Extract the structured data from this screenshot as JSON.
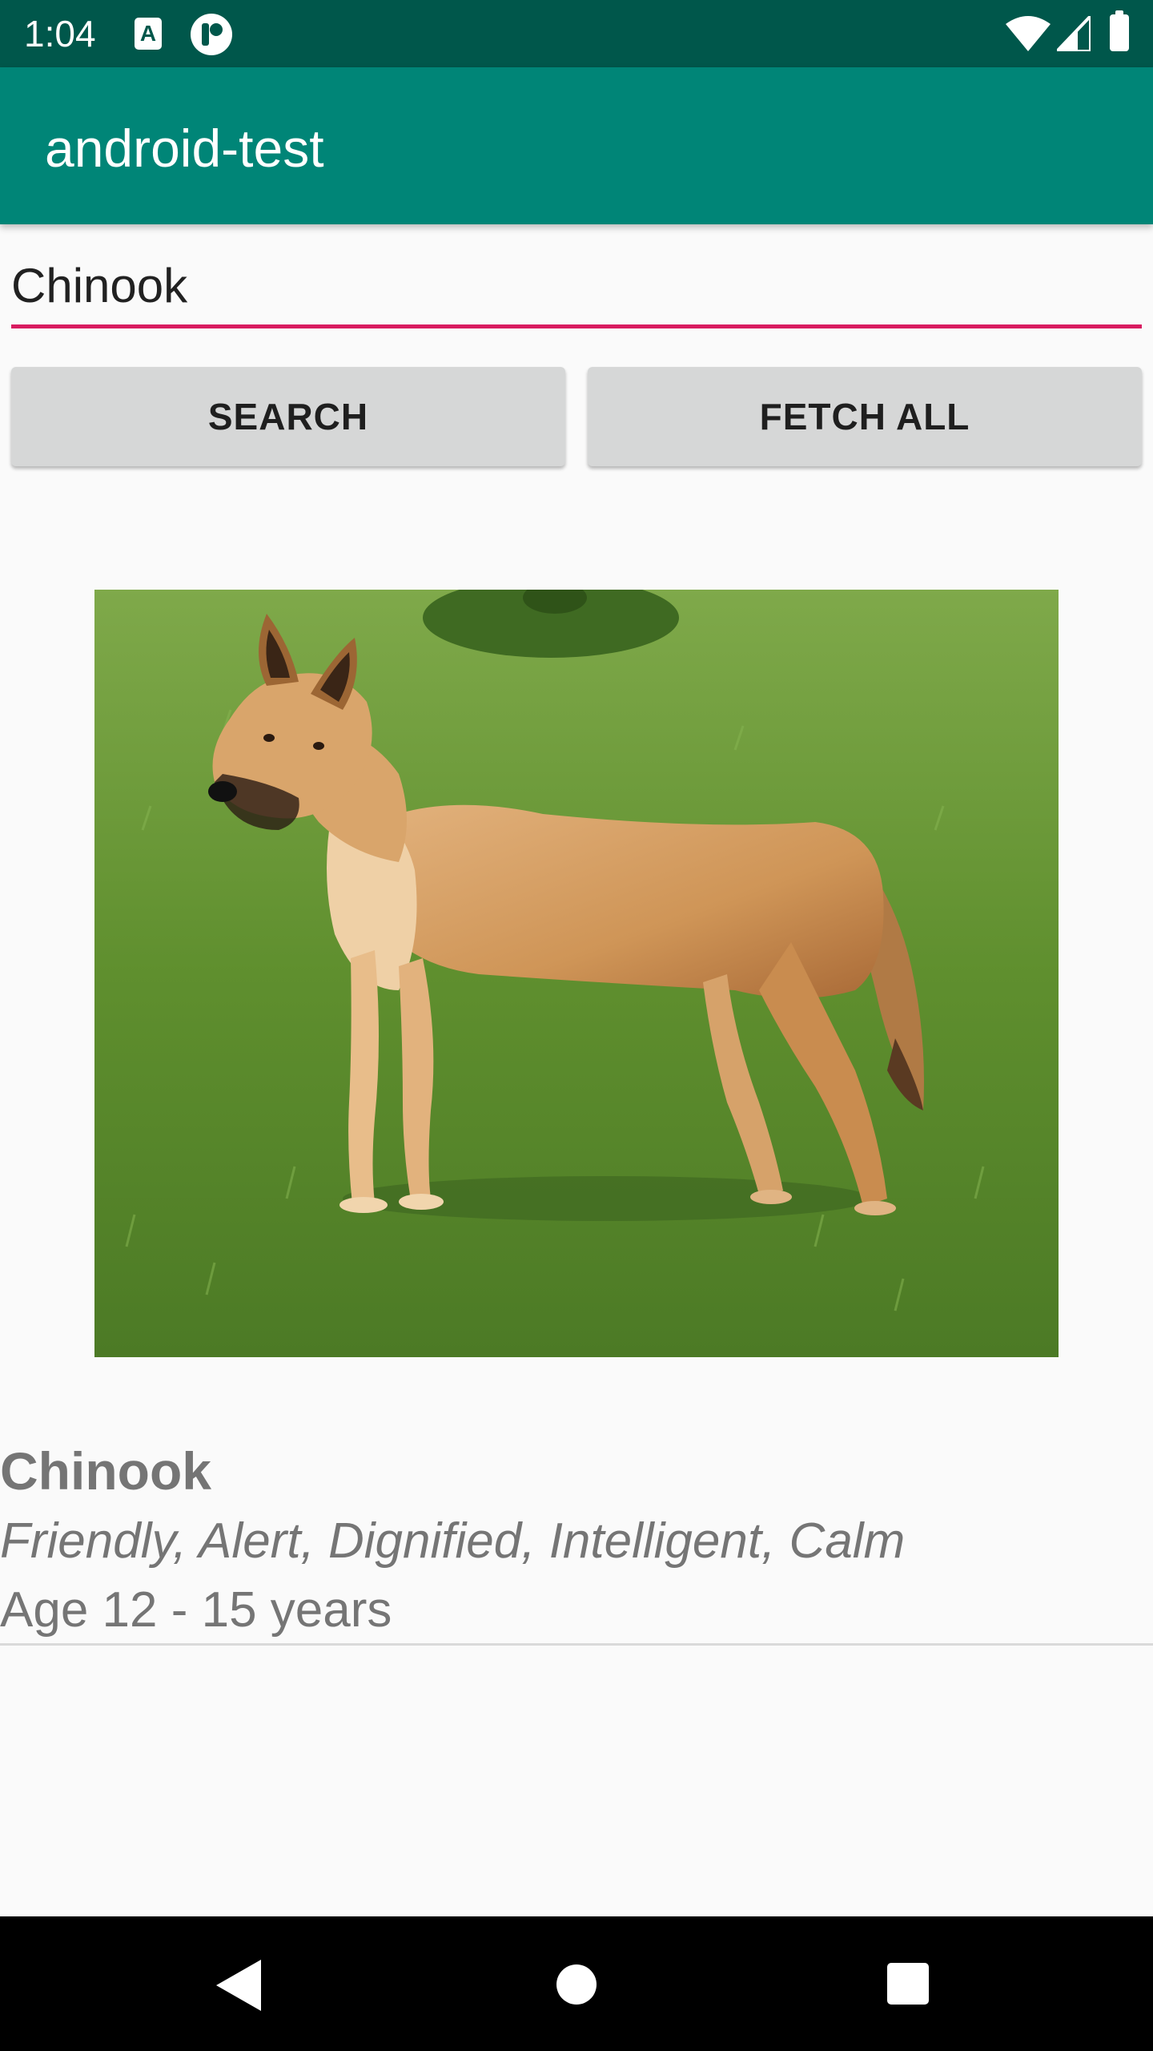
{
  "status_bar": {
    "time": "1:04",
    "icons": [
      "text-a-icon",
      "pocket-p-icon",
      "wifi-icon",
      "signal-icon",
      "battery-icon"
    ],
    "background": "#00574b"
  },
  "app_bar": {
    "title": "android-test",
    "background": "#008577"
  },
  "search": {
    "value": "Chinook",
    "underline_color": "#d81b60"
  },
  "buttons": {
    "search_label": "SEARCH",
    "fetch_all_label": "FETCH ALL"
  },
  "result": {
    "image": "dog-photo",
    "name": "Chinook",
    "temperament": "Friendly, Alert, Dignified, Intelligent, Calm",
    "life_span": "Age 12 - 15 years"
  },
  "nav_bar": {
    "icons": [
      "back-icon",
      "home-icon",
      "recents-icon"
    ]
  }
}
